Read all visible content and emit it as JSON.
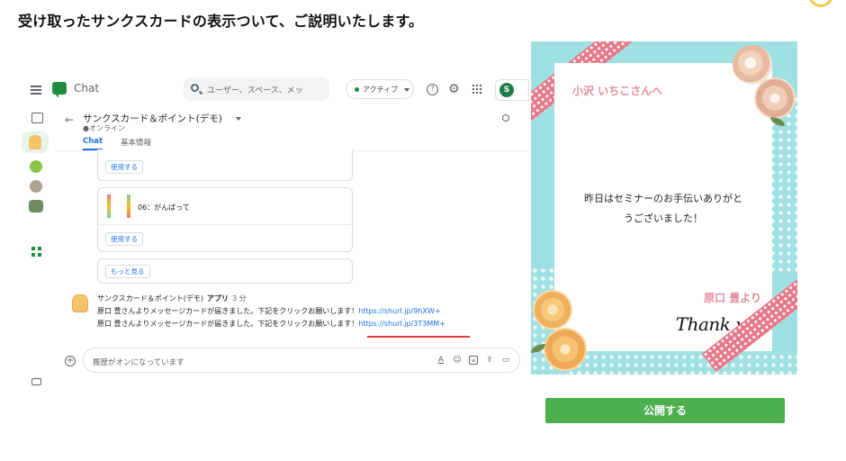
{
  "headline": "受け取ったサンクスカードの表示ついて、ご説明いたします。",
  "chat": {
    "app_name": "Chat",
    "search_placeholder": "ユーザー、スペース、メッ",
    "status": "アクティブ",
    "org_logo": "S",
    "space": {
      "title": "サンクスカード＆ポイント(デモ)",
      "status": "●オンライン",
      "tabs": [
        {
          "label": "Chat"
        },
        {
          "label": "基本情報"
        }
      ]
    },
    "cards": {
      "use_label": "使用する",
      "item_label": "06：がんばって",
      "more_label": "もっと見る"
    },
    "message": {
      "sender": "サンクスカード＆ポイント(デモ)",
      "app_tag": "アプリ",
      "time": "3 分",
      "line1_text": "原口 豊さんよりメッセージカードが届きました。下記をクリックお願いします！",
      "line1_link": "https://shurl.jp/9hXW+",
      "line2_text": "原口 豊さんよりメッセージカードが届きました。下記をクリックお願いします！",
      "line2_link": "https://shurl.jp/3T3MM+"
    },
    "compose_placeholder": "履歴がオンになっています",
    "icons": {
      "menu": "menu-icon",
      "search": "search-icon",
      "help": "help-icon",
      "settings": "gear-icon",
      "apps": "apps-grid-icon",
      "back": "arrow-left-icon",
      "add": "plus-circle-icon",
      "format": "text-format-icon",
      "emoji": "emoji-icon",
      "gif": "gif-icon",
      "upload": "upload-icon",
      "video": "video-icon"
    }
  },
  "thank_you_card": {
    "recipient": "小沢 いちこさんへ",
    "message_line1": "昨日はセミナーのお手伝いありがと",
    "message_line2": "うございました！",
    "sender": "原口 豊より",
    "signature": "Thank you"
  },
  "publish_button": "公開する",
  "colors": {
    "chat_green": "#1e8e3e",
    "link_blue": "#1a73e8",
    "card_teal": "#9fe0e2",
    "card_pink": "#e58a9b",
    "publish_green": "#4caf50",
    "highlight_red": "#e53935"
  }
}
